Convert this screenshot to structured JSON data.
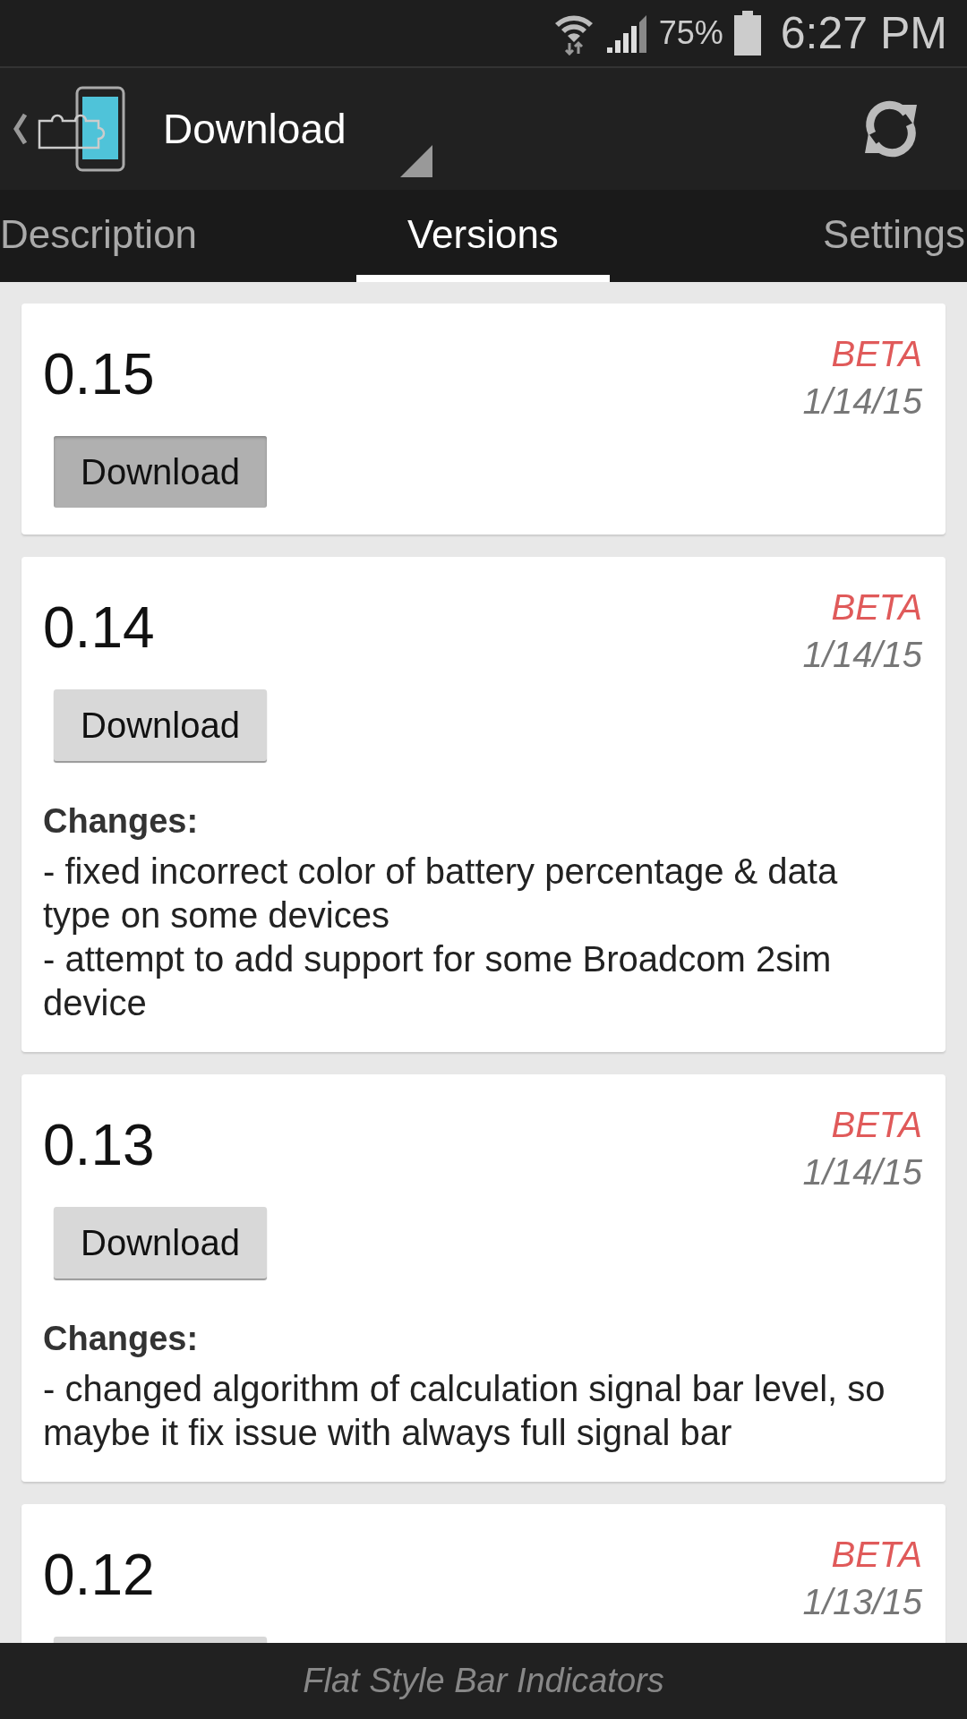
{
  "status_bar": {
    "battery": "75%",
    "time": "6:27 PM"
  },
  "action_bar": {
    "title": "Download"
  },
  "tabs": [
    {
      "label": "Description",
      "selected": false
    },
    {
      "label": "Versions",
      "selected": true
    },
    {
      "label": "Settings",
      "selected": false
    }
  ],
  "versions": [
    {
      "version": "0.15",
      "tag": "BETA",
      "date": "1/14/15",
      "button": {
        "label": "Download",
        "pressed": true
      }
    },
    {
      "version": "0.14",
      "tag": "BETA",
      "date": "1/14/15",
      "button": {
        "label": "Download",
        "pressed": false
      },
      "changes_heading": "Changes:",
      "changes": "- fixed incorrect color of battery percentage & data type on some devices\n- attempt to add support for some Broadcom 2sim device"
    },
    {
      "version": "0.13",
      "tag": "BETA",
      "date": "1/14/15",
      "button": {
        "label": "Download",
        "pressed": false
      },
      "changes_heading": "Changes:",
      "changes": "- changed algorithm of calculation signal bar level, so maybe it fix issue with always full signal bar"
    },
    {
      "version": "0.12",
      "tag": "BETA",
      "date": "1/13/15",
      "button": {
        "pressed": false
      }
    }
  ],
  "footer": "Flat Style Bar Indicators"
}
